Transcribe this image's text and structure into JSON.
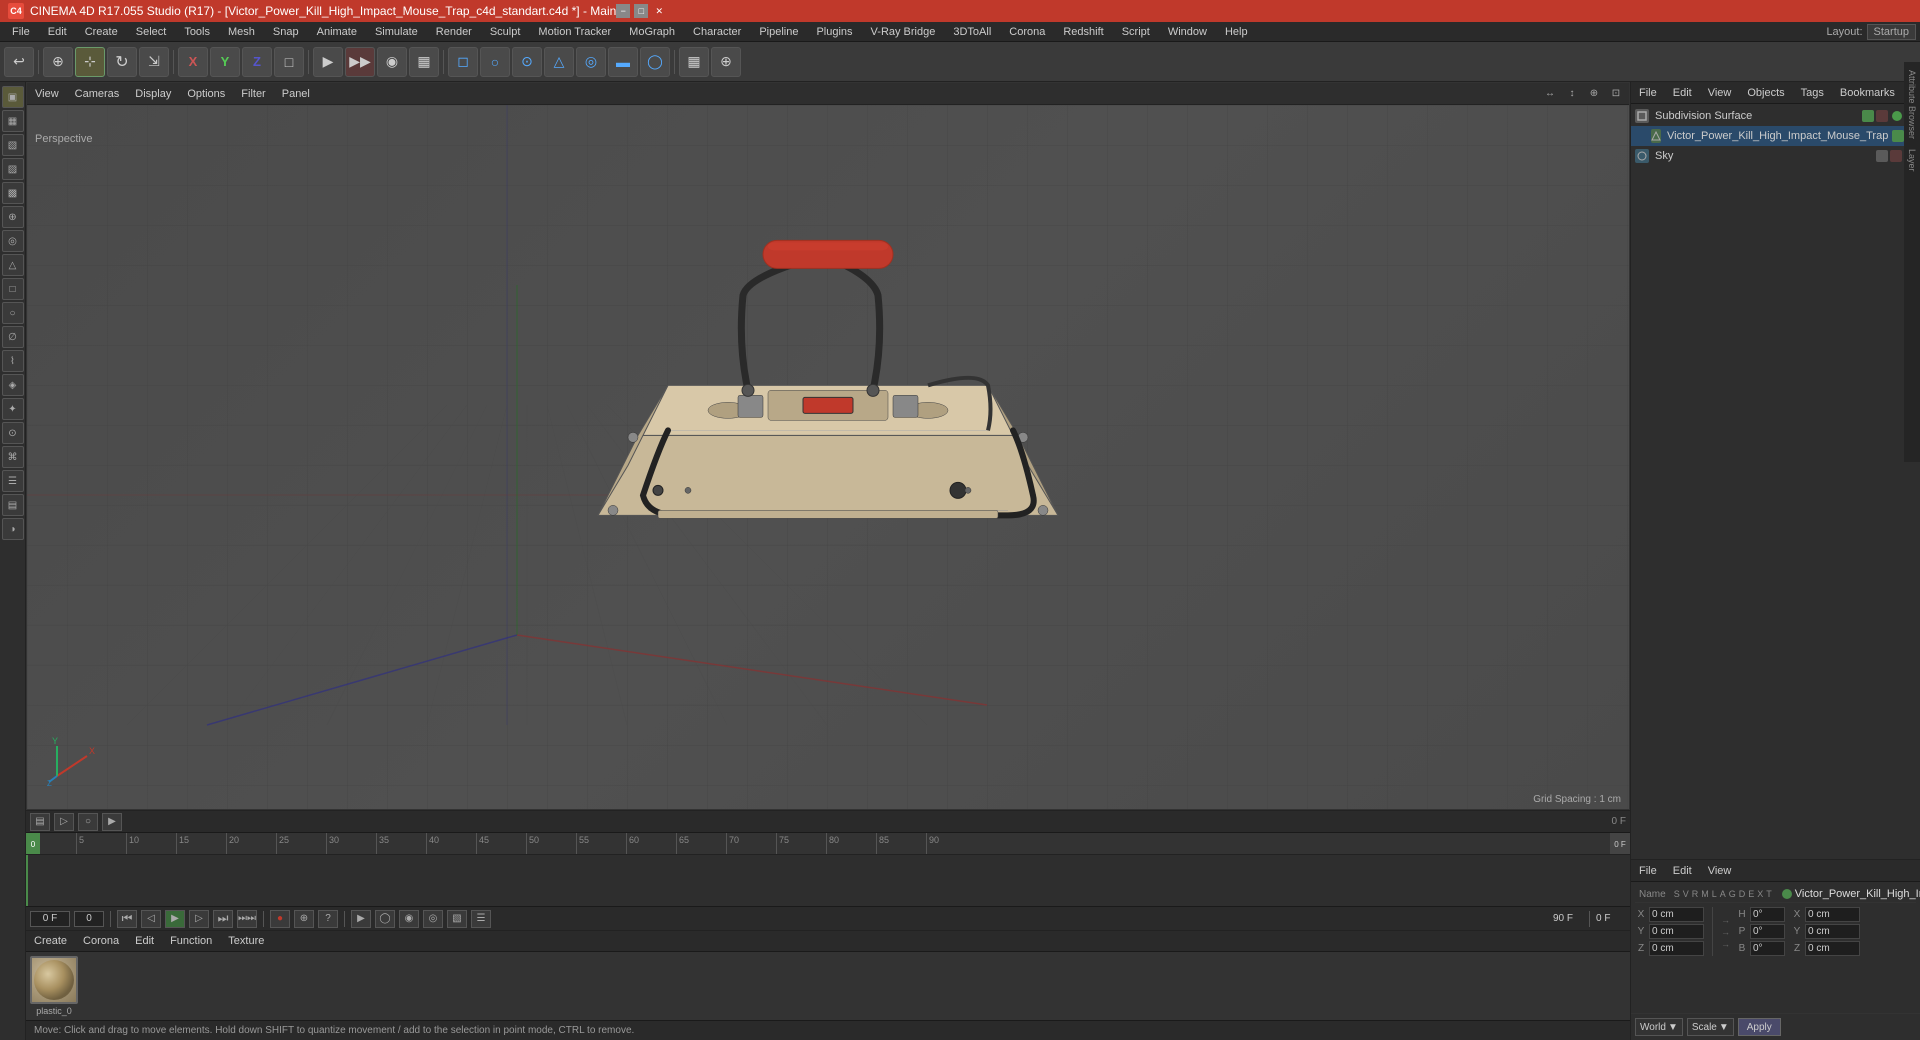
{
  "app": {
    "title": "CINEMA 4D R17.055 Studio (R17) - [Victor_Power_Kill_High_Impact_Mouse_Trap_c4d_standart.c4d *] - Main",
    "icon": "C4D"
  },
  "titlebar": {
    "controls": [
      "−",
      "□",
      "✕"
    ]
  },
  "menubar": {
    "items": [
      "File",
      "Edit",
      "Create",
      "Select",
      "Tools",
      "Mesh",
      "Snap",
      "Animate",
      "Simulate",
      "Render",
      "Sculpt",
      "Motion Tracker",
      "MoGraph",
      "Character",
      "Pipeline",
      "Plugins",
      "V-Ray Bridge",
      "3DToAll",
      "Corona",
      "Redshift",
      "Script",
      "Window",
      "Help"
    ],
    "layout_label": "Layout:",
    "layout_value": "Startup"
  },
  "toolbar": {
    "buttons": [
      "↩",
      "+",
      "⊕",
      "○",
      "→",
      "✕",
      "Y",
      "Z",
      "□",
      "▶",
      "▶",
      "▶",
      "●",
      "◉",
      "◎",
      "▦",
      "⊛",
      "◈",
      "⊕",
      "▤",
      "◑"
    ]
  },
  "viewport": {
    "perspective_label": "Perspective",
    "grid_spacing": "Grid Spacing : 1 cm",
    "menus": [
      "View",
      "Cameras",
      "Display",
      "Options",
      "Filter",
      "Panel"
    ],
    "icons": [
      "↔",
      "↕",
      "⊕",
      "⊡"
    ]
  },
  "left_sidebar": {
    "buttons": [
      "▣",
      "▦",
      "▧",
      "▨",
      "▩",
      "⊕",
      "◎",
      "△",
      "□",
      "○",
      "∅",
      "⌇",
      "◈",
      "✦",
      "⊙",
      "⌘",
      "☰",
      "▤",
      "◑"
    ]
  },
  "timeline": {
    "toolbar_buttons": [
      "▤",
      "▷",
      "○",
      "▶"
    ],
    "ruler_marks": [
      "0",
      "5",
      "10",
      "15",
      "20",
      "25",
      "30",
      "35",
      "40",
      "45",
      "50",
      "55",
      "60",
      "65",
      "70",
      "75",
      "80",
      "85",
      "90"
    ],
    "current_frame": "0 F",
    "frame_input": "0",
    "start_frame": "0 F",
    "end_frame": "90 F",
    "playback_buttons": [
      "⏮",
      "◁",
      "▶",
      "▷",
      "⏭",
      "⏭⏭"
    ]
  },
  "playback": {
    "frame_display": "0 F",
    "frame_field": "0",
    "end_field": "90 F",
    "buttons": [
      "⏮",
      "◁",
      "▷",
      "▶",
      "⏭",
      "●",
      "⊕",
      "?",
      "▶",
      "◯",
      "◉",
      "◎",
      "▧",
      "☰"
    ]
  },
  "object_manager": {
    "menus": [
      "File",
      "Edit",
      "View",
      "Objects",
      "Tags",
      "Bookmarks"
    ],
    "objects": [
      {
        "name": "Subdivision Surface",
        "icon": "subdiv",
        "indent": 0,
        "dot_color": "green",
        "actions": [
          "green",
          "red"
        ]
      },
      {
        "name": "Victor_Power_Kill_High_Impact_Mouse_Trap",
        "icon": "lo",
        "indent": 1,
        "dot_color": "green",
        "actions": [
          "green",
          "red"
        ]
      },
      {
        "name": "Sky",
        "icon": "sky",
        "indent": 0,
        "dot_color": "green",
        "actions": [
          "grey",
          "red"
        ]
      }
    ]
  },
  "attribute_manager": {
    "menus": [
      "File",
      "Edit",
      "View"
    ],
    "selected_object": "Victor_Power_Kill_High_Impact_Mouse_Trap",
    "columns": {
      "position": {
        "labels": [
          "X",
          "Y",
          "Z"
        ],
        "values": [
          "0 cm",
          "0 cm",
          "0 cm"
        ]
      },
      "rotation": {
        "labels": [
          "H",
          "P",
          "B"
        ],
        "values": [
          "0°",
          "0°",
          "0°"
        ]
      },
      "scale": {
        "labels": [
          "X",
          "Y",
          "Z"
        ],
        "values": [
          "0 cm",
          "0 cm",
          "0 cm"
        ]
      }
    },
    "bottom": {
      "coord_system": "World",
      "scale_mode": "Scale",
      "apply_btn": "Apply"
    }
  },
  "name_panel": {
    "label": "Name",
    "columns": [
      "S",
      "V",
      "R",
      "M",
      "L",
      "A",
      "G",
      "D",
      "E",
      "X",
      "T"
    ],
    "selected_name": "Victor_Power_Kill_High_Impact_Mouse_Trap"
  },
  "material_editor": {
    "menus": [
      "Create",
      "Corona",
      "Edit",
      "Function",
      "Texture"
    ],
    "materials": [
      {
        "name": "plastic_0",
        "preview_color": "#c8b898"
      }
    ]
  },
  "status_bar": {
    "message": "Move: Click and drag to move elements. Hold down SHIFT to quantize movement / add to the selection in point mode, CTRL to remove."
  },
  "colors": {
    "title_bar_bg": "#c0392b",
    "menu_bar_bg": "#2a2a2a",
    "toolbar_bg": "#3a3a3a",
    "viewport_bg": "#505050",
    "grid_color": "#3a3a3a",
    "panel_bg": "#2e2e2e",
    "selected_blue": "#2a4a6a",
    "accent_green": "#4a9a4a",
    "accent_red": "#9a3a3a"
  }
}
